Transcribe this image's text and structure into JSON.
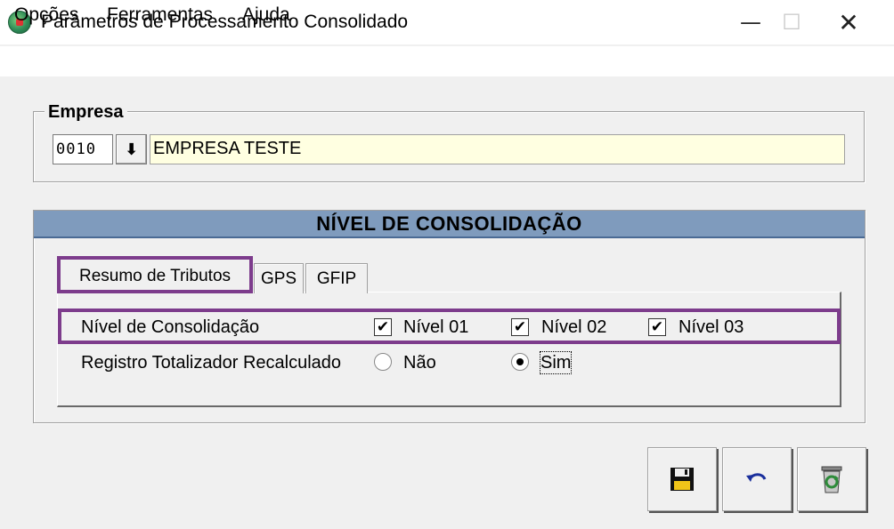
{
  "window": {
    "title": "Parâmetros de Processamento Consolidado",
    "minimize_glyph": "—",
    "maximize_glyph": "☐",
    "close_glyph": "✕"
  },
  "menu": {
    "items": [
      {
        "label": "Opções"
      },
      {
        "label": "Ferramentas"
      },
      {
        "label": "Ajuda"
      }
    ]
  },
  "empresa": {
    "legend": "Empresa",
    "code": "0010",
    "name": "EMPRESA TESTE",
    "lookup_glyph": "⬇"
  },
  "consolidacao": {
    "header": "NÍVEL DE CONSOLIDAÇÃO",
    "tabs": [
      {
        "label": "Resumo de Tributos",
        "selected": true
      },
      {
        "label": "GPS",
        "selected": false
      },
      {
        "label": "GFIP",
        "selected": false
      }
    ],
    "nivel_label": "Nível de Consolidação",
    "niveis": [
      {
        "label": "Nível 01",
        "checked": true,
        "mark": "✔"
      },
      {
        "label": "Nível 02",
        "checked": true,
        "mark": "✔"
      },
      {
        "label": "Nível 03",
        "checked": true,
        "mark": "✔"
      }
    ],
    "registro_label": "Registro Totalizador Recalculado",
    "registro_options": [
      {
        "label": "Não",
        "selected": false
      },
      {
        "label": "Sim",
        "selected": true
      }
    ]
  },
  "colors": {
    "header_bg": "#7f9bbd",
    "highlight": "#7d3c8c",
    "name_field_bg": "#ffffe1"
  },
  "icons": {
    "save": "floppy-disk-icon",
    "undo": "undo-arrow-icon",
    "delete": "recycle-bin-icon"
  }
}
